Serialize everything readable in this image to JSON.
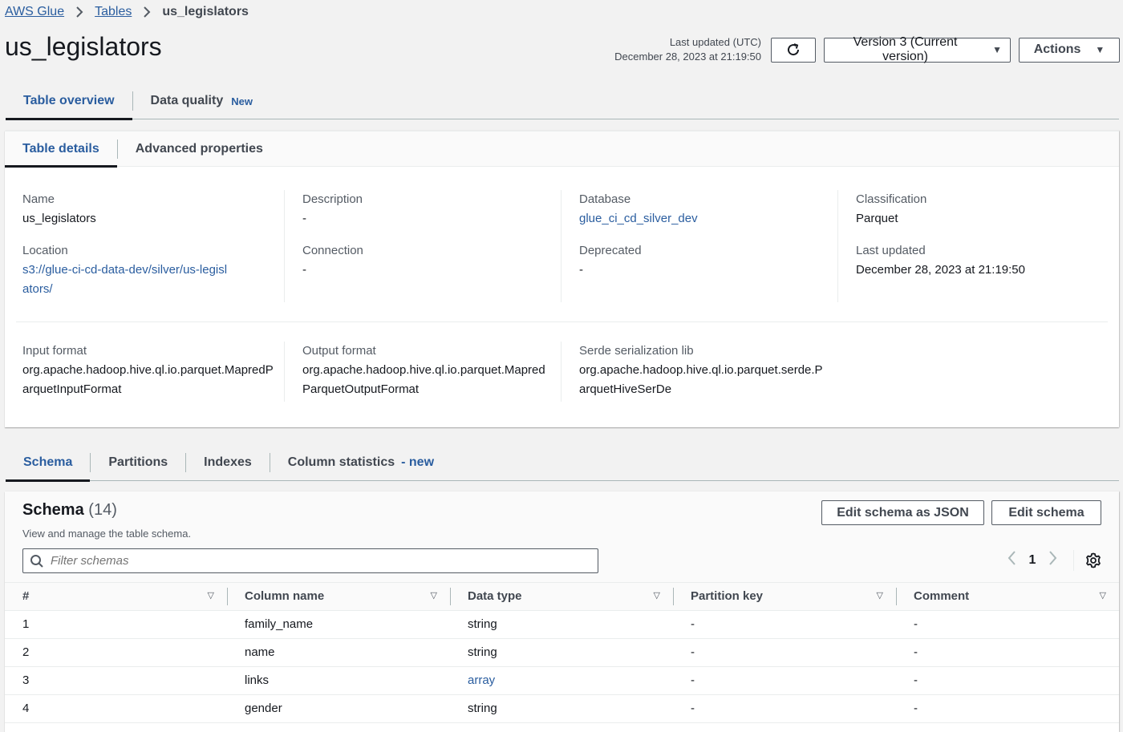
{
  "breadcrumb": {
    "items": [
      {
        "label": "AWS Glue"
      },
      {
        "label": "Tables"
      }
    ],
    "current": "us_legislators"
  },
  "page": {
    "title": "us_legislators",
    "last_updated_label": "Last updated (UTC)",
    "last_updated_value": "December 28, 2023 at 21:19:50",
    "version_label": "Version 3 (Current version)",
    "actions_label": "Actions"
  },
  "top_tabs": [
    {
      "label": "Table overview",
      "active": true
    },
    {
      "label": "Data quality",
      "badge": "New"
    }
  ],
  "details": {
    "tabs": [
      {
        "label": "Table details",
        "active": true
      },
      {
        "label": "Advanced properties"
      }
    ],
    "fields": {
      "name": {
        "label": "Name",
        "value": "us_legislators"
      },
      "description": {
        "label": "Description",
        "value": "-"
      },
      "database": {
        "label": "Database",
        "value": "glue_ci_cd_silver_dev"
      },
      "classification": {
        "label": "Classification",
        "value": "Parquet"
      },
      "location": {
        "label": "Location",
        "value": "s3://glue-ci-cd-data-dev/silver/us-legislators/"
      },
      "connection": {
        "label": "Connection",
        "value": "-"
      },
      "deprecated": {
        "label": "Deprecated",
        "value": "-"
      },
      "last_updated": {
        "label": "Last updated",
        "value": "December 28, 2023 at 21:19:50"
      },
      "input_format": {
        "label": "Input format",
        "value": "org.apache.hadoop.hive.ql.io.parquet.MapredParquetInputFormat"
      },
      "output_format": {
        "label": "Output format",
        "value": "org.apache.hadoop.hive.ql.io.parquet.MapredParquetOutputFormat"
      },
      "serde": {
        "label": "Serde serialization lib",
        "value": "org.apache.hadoop.hive.ql.io.parquet.serde.ParquetHiveSerDe"
      }
    }
  },
  "schema_tabs": [
    {
      "label": "Schema",
      "active": true
    },
    {
      "label": "Partitions"
    },
    {
      "label": "Indexes"
    },
    {
      "label": "Column statistics",
      "badge": "- new"
    }
  ],
  "schema": {
    "title": "Schema",
    "count": "(14)",
    "description": "View and manage the table schema.",
    "filter_placeholder": "Filter schemas",
    "edit_json_label": "Edit schema as JSON",
    "edit_label": "Edit schema",
    "current_page": "1",
    "columns": [
      "#",
      "Column name",
      "Data type",
      "Partition key",
      "Comment"
    ],
    "rows": [
      {
        "num": "1",
        "name": "family_name",
        "type": "string",
        "type_link": false,
        "partition": "-",
        "comment": "-"
      },
      {
        "num": "2",
        "name": "name",
        "type": "string",
        "type_link": false,
        "partition": "-",
        "comment": "-"
      },
      {
        "num": "3",
        "name": "links",
        "type": "array",
        "type_link": true,
        "partition": "-",
        "comment": "-"
      },
      {
        "num": "4",
        "name": "gender",
        "type": "string",
        "type_link": false,
        "partition": "-",
        "comment": "-"
      }
    ]
  },
  "colors": {
    "link": "#2a5d9f",
    "text": "#16191f",
    "muted": "#545b64",
    "background": "#f2f2f2"
  }
}
